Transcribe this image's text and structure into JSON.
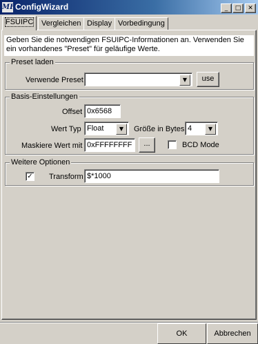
{
  "window": {
    "title": "ConfigWizard",
    "app_icon": "MF",
    "minimize_glyph": "_",
    "maximize_glyph": "□",
    "close_glyph": "✕"
  },
  "tabs": [
    {
      "label": "FSUIPC",
      "active": true
    },
    {
      "label": "Vergleichen",
      "active": false
    },
    {
      "label": "Display",
      "active": false
    },
    {
      "label": "Vorbedingung",
      "active": false
    }
  ],
  "info_text": "Geben Sie die notwendigen FSUIPC-Informationen an. Verwenden Sie ein vorhandenes \"Preset\" für geläufige Werte.",
  "preset_group": {
    "title": "Preset laden",
    "label": "Verwende Preset",
    "value": "",
    "use_button": "use"
  },
  "basis_group": {
    "title": "Basis-Einstellungen",
    "offset_label": "Offset",
    "offset_value": "0x6568",
    "wert_typ_label": "Wert Typ",
    "wert_typ_value": "Float",
    "groesse_label": "Größe in Bytes",
    "groesse_value": "4",
    "mask_label": "Maskiere Wert mit",
    "mask_value": "0xFFFFFFFF",
    "mask_button": "...",
    "bcd_label": "BCD Mode",
    "bcd_checked": false
  },
  "weitere_group": {
    "title": "Weitere Optionen",
    "transform_label": "Transform",
    "transform_checked": true,
    "transform_value": "$*1000"
  },
  "footer": {
    "ok_label": "OK",
    "cancel_label": "Abbrechen"
  },
  "icons": {
    "dropdown": "▼",
    "checkmark": "✓"
  },
  "colors": {
    "titlebar_start": "#0a246a",
    "titlebar_end": "#a6caf0",
    "face": "#d4d0c8"
  }
}
